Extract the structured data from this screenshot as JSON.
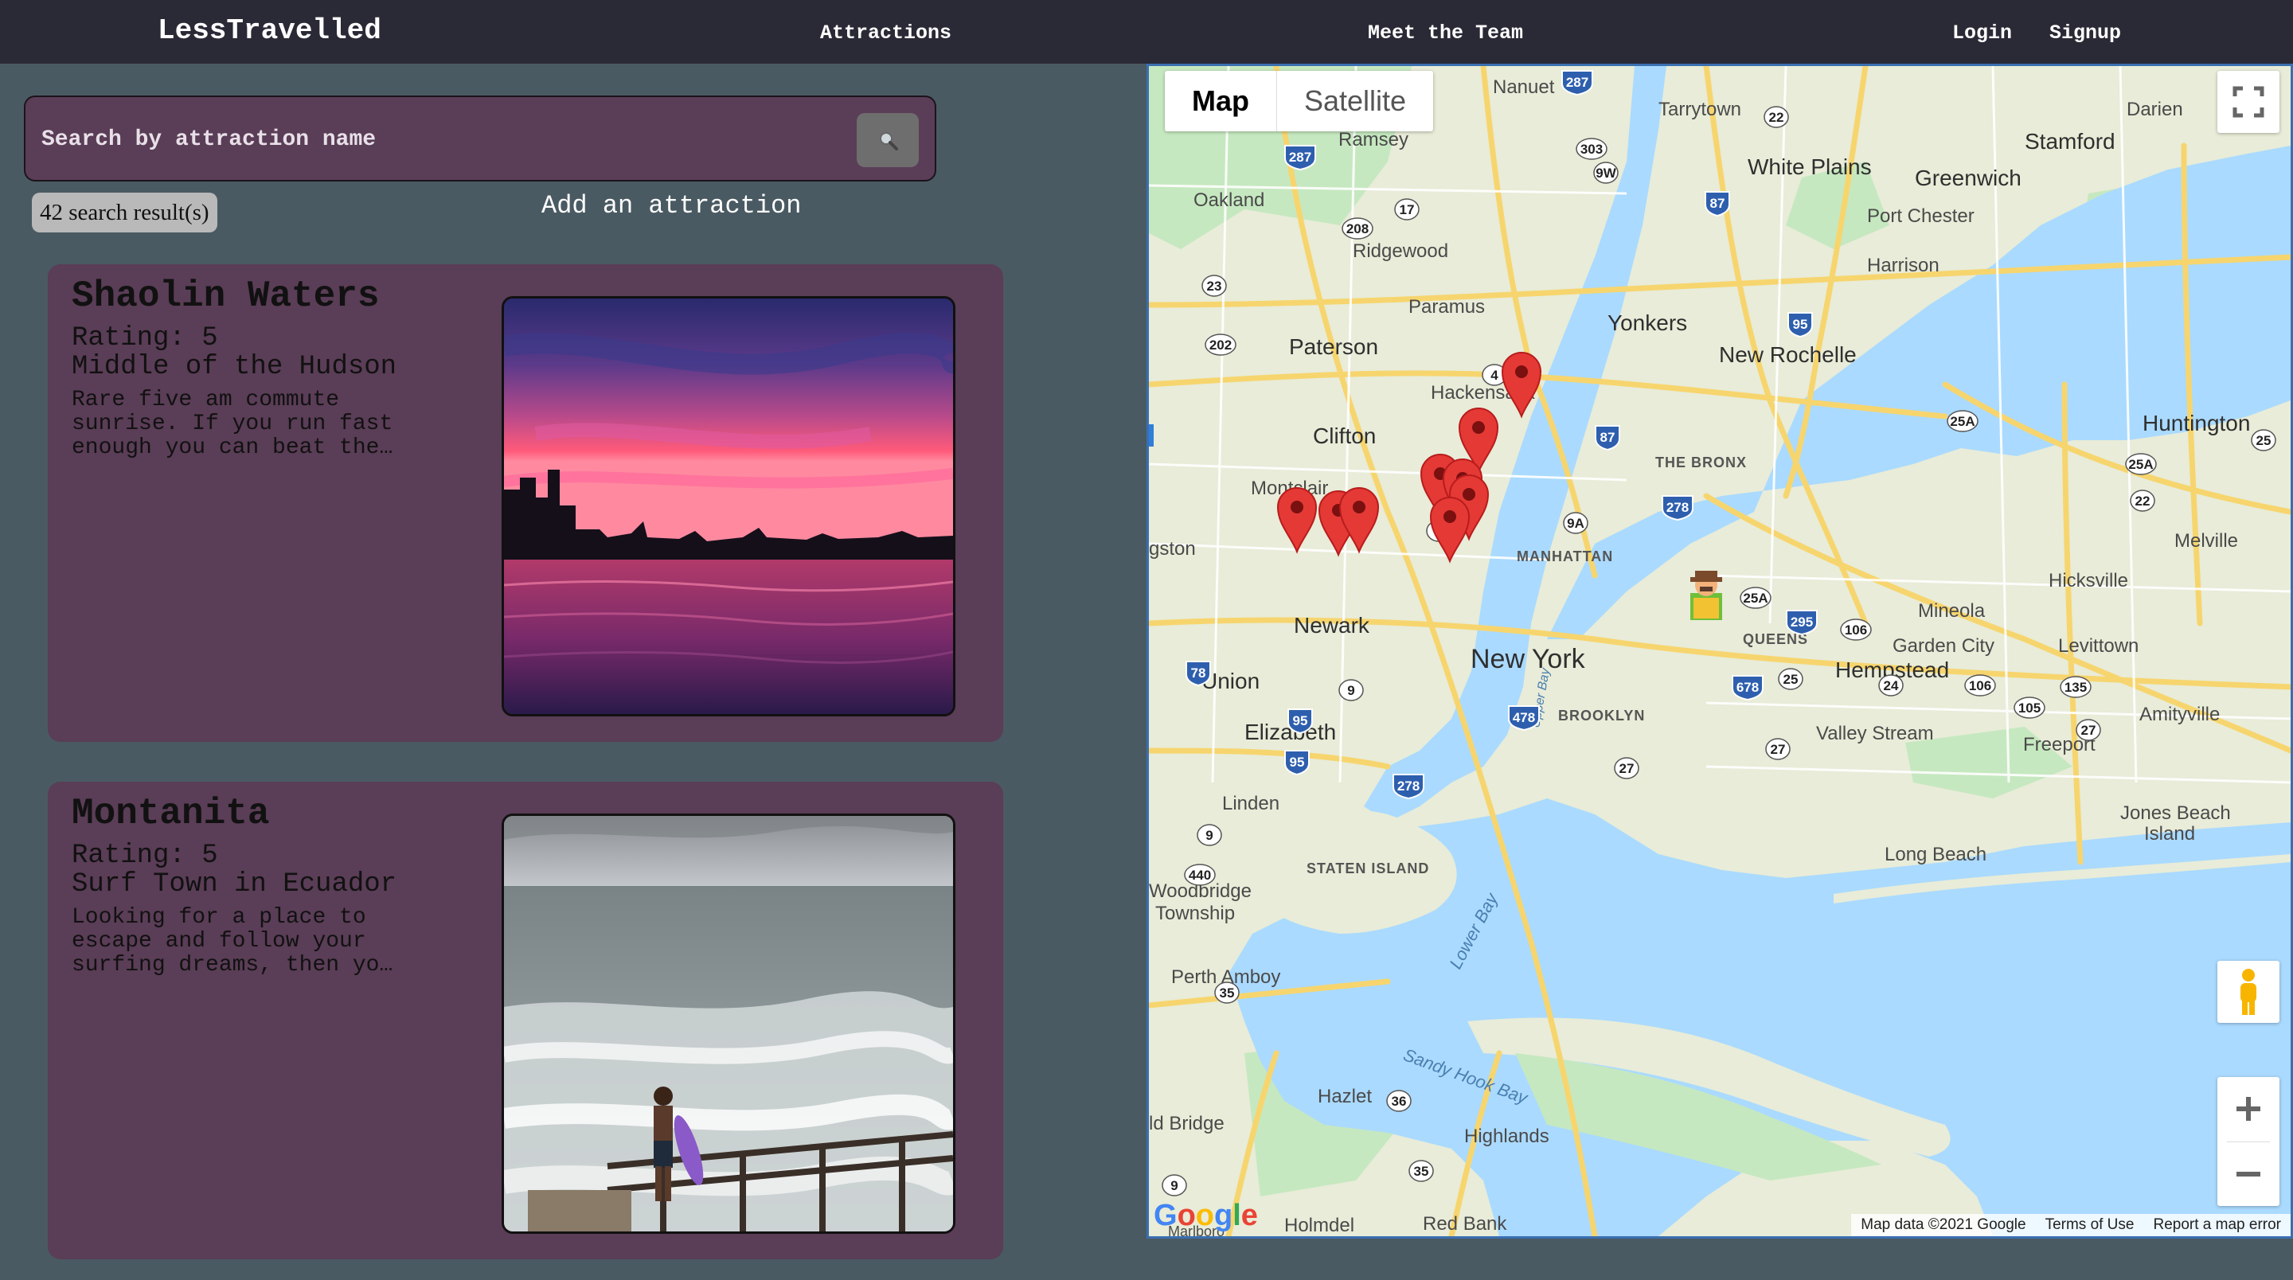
{
  "nav": {
    "brand": "LessTravelled",
    "links": [
      "Attractions",
      "Meet the Team",
      "Login",
      "Signup"
    ]
  },
  "search": {
    "placeholder": "Search by attraction name",
    "button_icon": "search-icon"
  },
  "results": {
    "count_text": "42 search result(s)"
  },
  "add_attraction": "Add an attraction",
  "cards": [
    {
      "title": "Shaolin Waters",
      "rating": "Rating: 5",
      "subtitle": "Middle of the Hudson",
      "description": "Rare five am commute sunrise. If you run fast enough you can beat the…"
    },
    {
      "title": "Montanita",
      "rating": "Rating: 5",
      "subtitle": "Surf Town in Ecuador",
      "description": "Looking for a place to escape and follow your surfing dreams, then yo…"
    }
  ],
  "map": {
    "types": [
      "Map",
      "Satellite"
    ],
    "active_type": "Map",
    "labels": {
      "nanuet": "Nanuet",
      "tarrytown": "Tarrytown",
      "darien": "Darien",
      "ramsey": "Ramsey",
      "stamford": "Stamford",
      "white_plains": "White Plains",
      "greenwich": "Greenwich",
      "oakland": "Oakland",
      "port_chester": "Port Chester",
      "ridgewood": "Ridgewood",
      "harrison": "Harrison",
      "paramus": "Paramus",
      "yonkers": "Yonkers",
      "paterson": "Paterson",
      "new_rochelle": "New Rochelle",
      "hackensack": "Hackensack",
      "clifton": "Clifton",
      "huntington": "Huntington",
      "the_bronx": "THE BRONX",
      "montclair": "Montclair",
      "livingston": "gston",
      "manhattan": "MANHATTAN",
      "melville": "Melville",
      "hicksville": "Hicksville",
      "mineola": "Mineola",
      "newark": "Newark",
      "queens": "QUEENS",
      "garden_city": "Garden City",
      "levittown": "Levittown",
      "new_york": "New York",
      "union": "Union",
      "hempstead": "Hempstead",
      "brooklyn": "BROOKLYN",
      "amityville": "Amityville",
      "elizabeth": "Elizabeth",
      "valley_stream": "Valley Stream",
      "freeport": "Freeport",
      "linden": "Linden",
      "jones_beach": "Jones Beach",
      "jones_island": "Island",
      "long_beach": "Long Beach",
      "staten_island": "STATEN ISLAND",
      "woodbridge": "Woodbridge",
      "township": "Township",
      "lower_bay": "Lower Bay",
      "perth_amboy": "Perth Amboy",
      "sandy_hook_bay": "Sandy Hook Bay",
      "hazlet": "Hazlet",
      "old_bridge": "ld Bridge",
      "highlands": "Highlands",
      "holmdel": "Holmdel",
      "red_bank": "Red Bank",
      "upper_bay": "Upper Bay",
      "marlboro": "Marlboro"
    },
    "shields": [
      "287",
      "303",
      "9W",
      "22",
      "287",
      "87",
      "17",
      "208",
      "23",
      "202",
      "95",
      "4",
      "87",
      "278",
      "9A",
      "3",
      "25A",
      "295",
      "106",
      "78",
      "9",
      "678",
      "25",
      "24",
      "106",
      "135",
      "105",
      "27",
      "95",
      "27",
      "278",
      "440",
      "35",
      "36",
      "35",
      "9",
      "25A",
      "25A",
      "25",
      "22",
      "478",
      "95",
      "9",
      "27"
    ],
    "footer": [
      "Map data ©2021 Google",
      "Terms of Use",
      "Report a map error"
    ],
    "logo": "Google",
    "colors": {
      "water": "#aadaff",
      "land": "#e8ecd8",
      "park": "#c6e8c0",
      "road": "#f7d56e",
      "pin": "#e53935"
    }
  }
}
